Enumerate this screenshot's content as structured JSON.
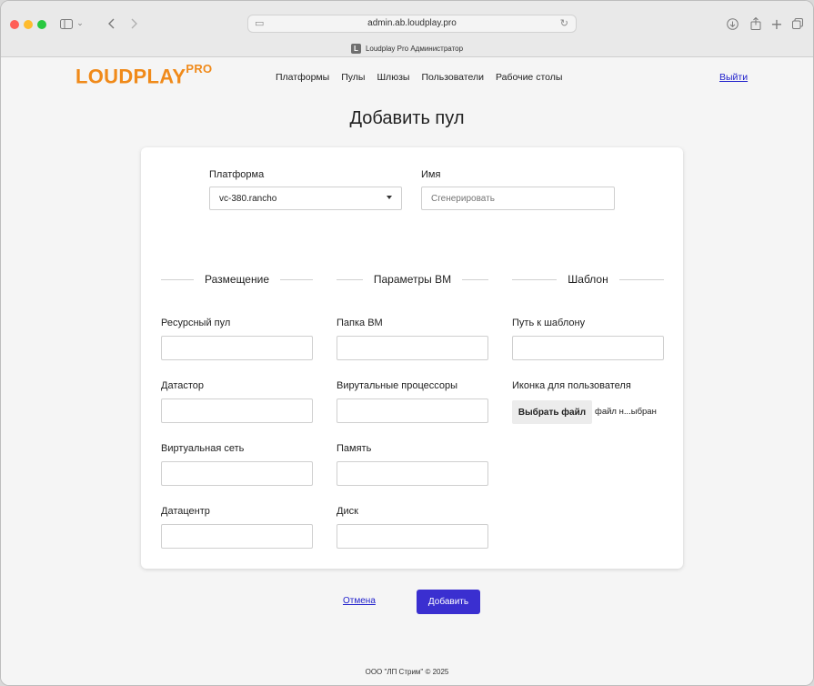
{
  "browser": {
    "url": "admin.ab.loudplay.pro",
    "tab_title": "Loudplay Pro Администратор",
    "tab_favicon": "L"
  },
  "header": {
    "logo_text": "LOUDPLAY",
    "logo_sup": "PRO",
    "nav": [
      "Платформы",
      "Пулы",
      "Шлюзы",
      "Пользователи",
      "Рабочие столы"
    ],
    "logout": "Выйти"
  },
  "page_title": "Добавить пул",
  "form": {
    "platform_label": "Платформа",
    "platform_value": "vc-380.rancho",
    "name_label": "Имя",
    "name_placeholder": "Сгенерировать",
    "sections": [
      "Размещение",
      "Параметры ВМ",
      "Шаблон"
    ],
    "placement": [
      "Ресурсный пул",
      "Датастор",
      "Виртуальная сеть",
      "Датацентр"
    ],
    "vm_params": [
      "Папка ВМ",
      "Вирутальные процессоры",
      "Память",
      "Диск"
    ],
    "template_path_label": "Путь к шаблону",
    "icon_label": "Иконка для пользователя",
    "file_button": "Выбрать файл",
    "file_status": "файл н...ыбран"
  },
  "actions": {
    "cancel": "Отмена",
    "add": "Добавить"
  },
  "footer": "ООО \"ЛП Стрим\" © 2025",
  "colors": {
    "brand": "#f08a1a",
    "primary_button": "#3a2fd0",
    "link": "#2222cc"
  }
}
